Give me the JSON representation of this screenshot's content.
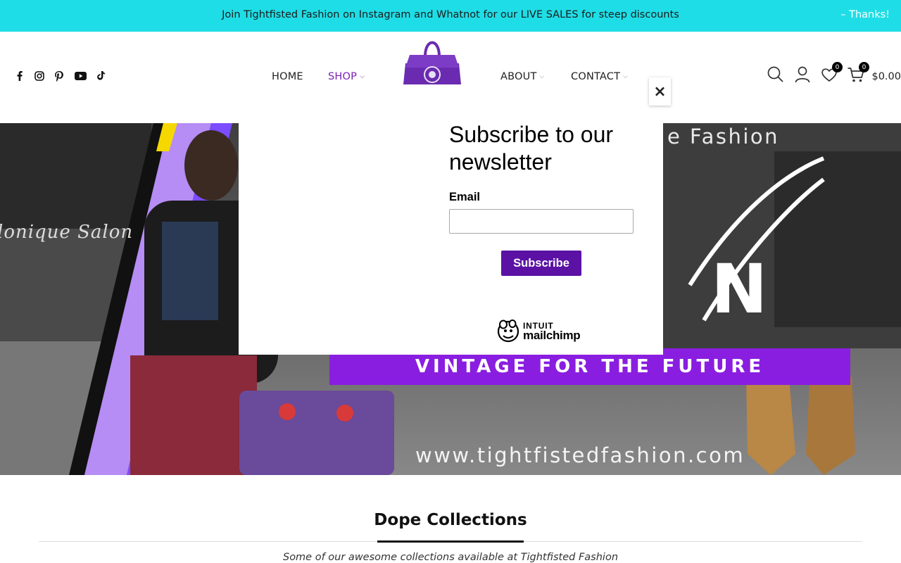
{
  "announcement": {
    "text": "Join Tightfisted Fashion on Instagram and Whatnot for our LIVE SALES for steep discounts",
    "close_label": "– Thanks!"
  },
  "social_icons": [
    "facebook-icon",
    "instagram-icon",
    "pinterest-icon",
    "youtube-icon",
    "tiktok-icon"
  ],
  "nav": {
    "home": "HOME",
    "shop": "SHOP",
    "about": "ABOUT",
    "contact": "CONTACT"
  },
  "header_icons": {
    "search": "search-icon",
    "account": "user-icon",
    "wishlist": "heart-icon",
    "cart": "cart-icon",
    "wishlist_count": "0",
    "cart_count": "0",
    "cart_total": "$0.00"
  },
  "hero": {
    "banner": "VINTAGE FOR THE FUTURE",
    "url": "www.tightfistedfashion.com",
    "partial_heading": "e Fashion",
    "storefront_sign": "lonique  Salon",
    "partial_letter": "N"
  },
  "collections": {
    "title": "Dope Collections",
    "subtitle": "Some of our awesome collections available at Tightfisted Fashion"
  },
  "popup": {
    "title": "Subscribe to our newsletter",
    "email_label": "Email",
    "email_value": "",
    "submit_label": "Subscribe",
    "close_symbol": "×",
    "brand_top": "INTUIT",
    "brand_bottom": "mailchimp"
  },
  "colors": {
    "announcement_bg": "#1fdde6",
    "accent_purple": "#7a1fb6",
    "subscribe_button": "#5a11a4",
    "banner_purple": "#8a1ee0"
  }
}
